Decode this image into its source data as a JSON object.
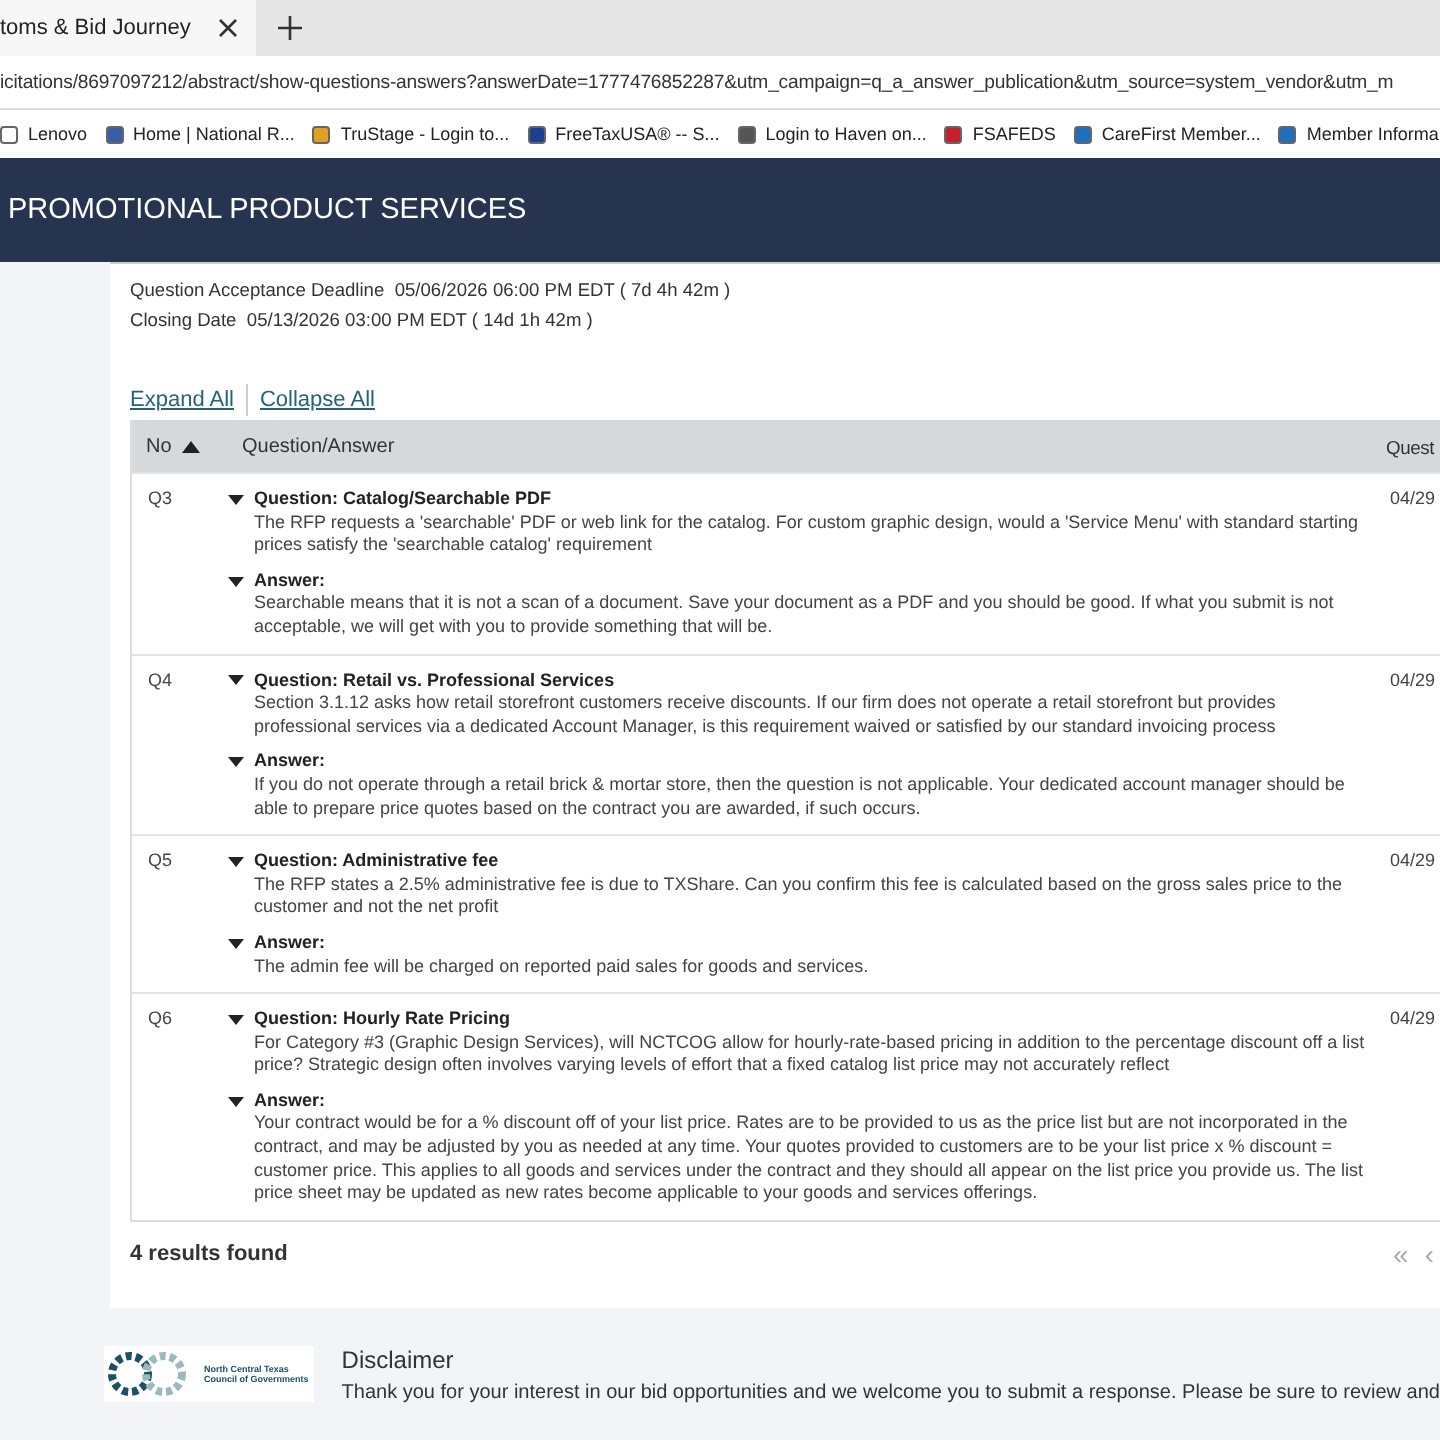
{
  "browser": {
    "tab": {
      "title": "toms & Bid Journey"
    },
    "address": "icitations/8697097212/abstract/show-questions-answers?answerDate=1777476852287&utm_campaign=q_a_answer_publication&utm_source=system_vendor&utm_m",
    "bookmarks": [
      {
        "label": "Lenovo",
        "color": "#ffffff"
      },
      {
        "label": "Home | National R...",
        "color": "#3a5da8"
      },
      {
        "label": "TruStage - Login to...",
        "color": "#e0a020"
      },
      {
        "label": "FreeTaxUSA® -- S...",
        "color": "#1d3f8f"
      },
      {
        "label": "Login to Haven on...",
        "color": "#555555"
      },
      {
        "label": "FSAFEDS",
        "color": "#c8202a"
      },
      {
        "label": "CareFirst Member...",
        "color": "#1f6fc0"
      },
      {
        "label": "Member Informa",
        "color": "#1f6fc0"
      }
    ]
  },
  "header": {
    "title": "PROMOTIONAL PRODUCT SERVICES"
  },
  "deadlines": [
    {
      "label": "Question Acceptance Deadline",
      "value": "05/06/2026 06:00 PM EDT ( 7d 4h 42m )"
    },
    {
      "label": "Closing Date",
      "value": "05/13/2026 03:00 PM EDT ( 14d 1h 42m )"
    }
  ],
  "links": [
    "Expand All",
    "Collapse All"
  ],
  "table": {
    "columns": [
      {
        "label": "No",
        "sorted_ascending": true
      },
      {
        "label": "Question/Answer"
      },
      {
        "label": "Quest"
      }
    ],
    "rows": [
      {
        "no": "Q3",
        "date": "04/29",
        "question": {
          "title": "Question: Catalog/Searchable PDF",
          "expanded": true,
          "text": "The RFP requests a 'searchable' PDF or web link for the catalog. For custom graphic design, would a 'Service Menu' with standard starting prices satisfy the 'searchable catalog' requirement"
        },
        "answer": {
          "title": "Answer:",
          "expanded": true,
          "text": "Searchable means that it is not a scan of a document. Save your document as a PDF and you should be good. If what you submit is not acceptable, we will get with you to provide something that will be."
        }
      },
      {
        "no": "Q4",
        "date": "04/29",
        "question": {
          "title": "Question: Retail vs. Professional Services",
          "expanded": true,
          "text": "Section 3.1.12 asks how retail storefront customers receive discounts. If our firm does not operate a retail storefront but provides professional services via a dedicated Account Manager, is this requirement waived or satisfied by our standard invoicing process"
        },
        "answer": {
          "title": "Answer:",
          "expanded": true,
          "text": "If you do not operate through a retail brick & mortar store, then the question is not applicable. Your dedicated account manager should be able to prepare price quotes based on the contract you are awarded, if such occurs."
        }
      },
      {
        "no": "Q5",
        "date": "04/29",
        "question": {
          "title": "Question: Administrative fee",
          "expanded": true,
          "text": "The RFP states a 2.5% administrative fee is due to TXShare. Can you confirm this fee is calculated based on the gross sales price to the customer and not the net profit"
        },
        "answer": {
          "title": "Answer:",
          "expanded": true,
          "text": "The admin fee will be charged on reported paid sales for goods and services."
        }
      },
      {
        "no": "Q6",
        "date": "04/29",
        "question": {
          "title": "Question: Hourly Rate Pricing",
          "expanded": true,
          "text": "For Category #3 (Graphic Design Services), will NCTCOG allow for hourly-rate-based pricing in addition to the percentage discount off a list price? Strategic design often involves varying levels of effort that a fixed catalog list price may not accurately reflect"
        },
        "answer": {
          "title": "Answer:",
          "expanded": true,
          "text": "Your contract would be for a % discount off of your list price. Rates are to be provided to us as the price list but are not incorporated in the contract, and may be adjusted by you as needed at any time. Your quotes provided to customers are to be your list price x % discount = customer price. This applies to all goods and services under the contract and they should all appear on the list price you provide us. The list price sheet may be updated as new rates become applicable to your goods and services offerings."
        }
      }
    ]
  },
  "results": "4 results found",
  "pagination": [
    "«",
    "‹"
  ],
  "footer": {
    "logo": [
      "North Central Texas",
      "Council of Governments"
    ],
    "title": "Disclaimer",
    "text": "Thank you for your interest in our bid opportunities and we welcome you to submit a response.  Please be sure to review and"
  }
}
